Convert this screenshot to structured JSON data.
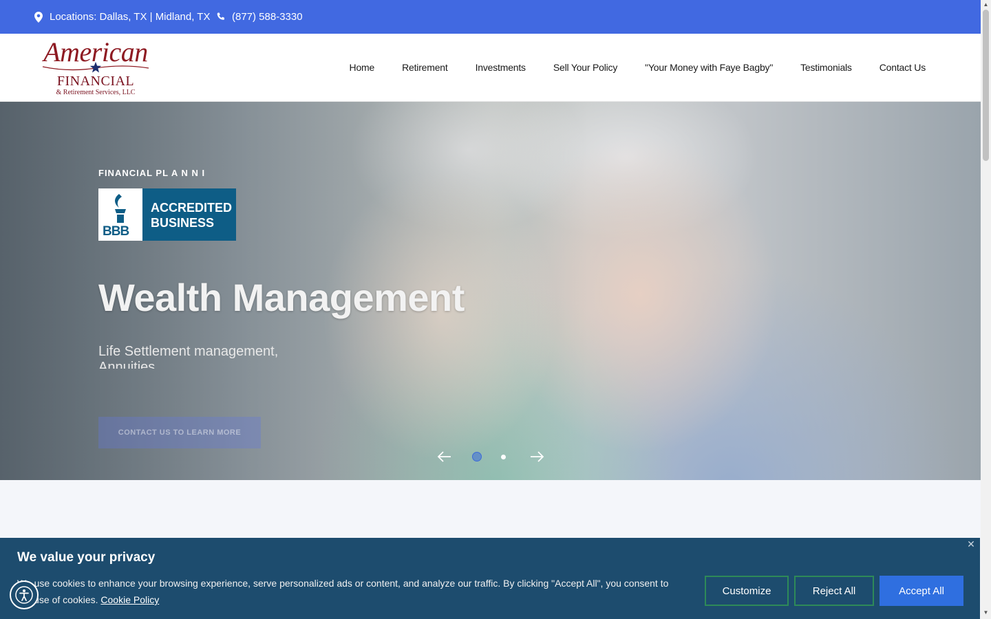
{
  "topbar": {
    "locations": "Locations: Dallas, TX | Midland, TX",
    "phone": "(877) 588-3330",
    "bg_color": "#4169e1"
  },
  "logo": {
    "script": "American",
    "name": "FINANCIAL",
    "sub": "& Retirement Services, LLC"
  },
  "nav": {
    "items": [
      "Home",
      "Retirement",
      "Investments",
      "Sell Your Policy",
      "\"Your Money with Faye Bagby\"",
      "Testimonials",
      "Contact Us"
    ]
  },
  "hero": {
    "eyebrow": "FINANCIAL PL A  N  N  I",
    "badge": {
      "line1": "ACCREDITED",
      "line2": "BUSINESS",
      "mark": "BBB"
    },
    "headline": "Wealth Management",
    "description": "Life Settlement management, Annuities,",
    "cta": "CONTACT US TO LEARN MORE",
    "slider": {
      "active_index": 0,
      "count": 2
    }
  },
  "cookie": {
    "title": "We value your privacy",
    "text": "We use cookies to enhance your browsing experience, serve personalized ads or content, and analyze our traffic. By clicking \"Accept All\", you consent to our use of cookies.",
    "policy_link": "Cookie Policy",
    "customize": "Customize",
    "reject": "Reject All",
    "accept": "Accept All",
    "bg_color": "#1d4c6e",
    "accent_color": "#2f6fe0"
  },
  "icons": {
    "location": "map-pin-icon",
    "phone": "phone-icon",
    "accessibility": "accessibility-icon"
  }
}
